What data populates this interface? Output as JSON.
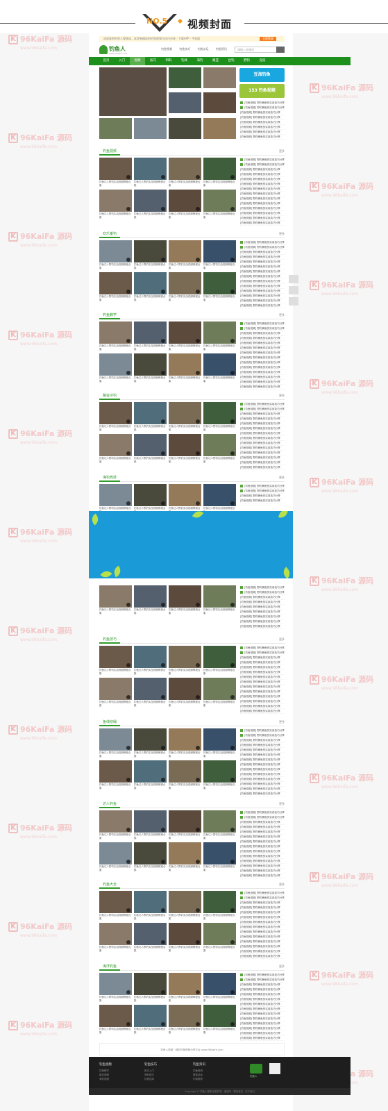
{
  "banner": {
    "badge": "NO.5",
    "title": "视频封面"
  },
  "watermark": {
    "brand": "96KaiFa 源码",
    "url": "www.96kaifa.com",
    "k": "K"
  },
  "header": {
    "topbar_text": "欢迎来到钓鱼人视频站，这里有精彩的钓鱼视频与技巧分享 · 下载APP · 手机版",
    "topbar_button": "立即登录",
    "logo_text": "钓鱼人",
    "logo_url": "www.diaoyur.com",
    "links": [
      "钓鱼视频",
      "钓鱼技巧",
      "钓鱼论坛",
      "钓鱼资讯",
      "手机版"
    ],
    "search_placeholder": "请输入关键词"
  },
  "nav": {
    "items": [
      "首页",
      "入门",
      "视频",
      "技巧",
      "饵料",
      "钓具",
      "海钓",
      "路亚",
      "台钓",
      "野钓",
      "竞技"
    ],
    "active_index": 2
  },
  "promos": [
    {
      "label": "豆海钓鱼",
      "color": "#19a7e0"
    },
    {
      "label": "153 钓鱼视频",
      "color": "#9bc63a"
    }
  ],
  "sections": [
    {
      "title": "钓鱼视频",
      "more": "更多"
    },
    {
      "title": "欢乐垂钓",
      "more": "更多"
    },
    {
      "title": "钓鱼教学",
      "more": "更多"
    },
    {
      "title": "路亚冰钓",
      "more": "更多"
    },
    {
      "title": "海钓竞技",
      "more": "更多"
    },
    {
      "title": "钓鱼技巧",
      "more": "更多"
    },
    {
      "title": "鱼线结绳",
      "more": "更多"
    },
    {
      "title": "达人钓鱼",
      "more": "更多"
    },
    {
      "title": "钓鱼大全",
      "more": "更多"
    },
    {
      "title": "海洋钓鱼",
      "more": "更多"
    }
  ],
  "thumb_caption": "钓鱼达人野钓实战视频教程合集",
  "list_item": "[钓鱼视频] 野钓鲫鱼的实用技巧分享",
  "footer": {
    "note": "钓鱼人视频 · 精彩钓鱼视频分享平台 www.96kaifa.com",
    "cols": [
      {
        "h": "钓鱼视频",
        "links": [
          "钓鱼教学",
          "路亚视频",
          "海钓视频"
        ]
      },
      {
        "h": "钓鱼技巧",
        "links": [
          "新手入门",
          "饵料配方",
          "钓具选择"
        ]
      },
      {
        "h": "钓鱼资讯",
        "links": [
          "钓鱼新闻",
          "赛事活动",
          "钓场推荐"
        ]
      }
    ],
    "app": "钓鱼人",
    "copyright": "Copyright © 钓鱼人视频 版权所有 · 备案号 · 联系我们 · 关于我们"
  }
}
